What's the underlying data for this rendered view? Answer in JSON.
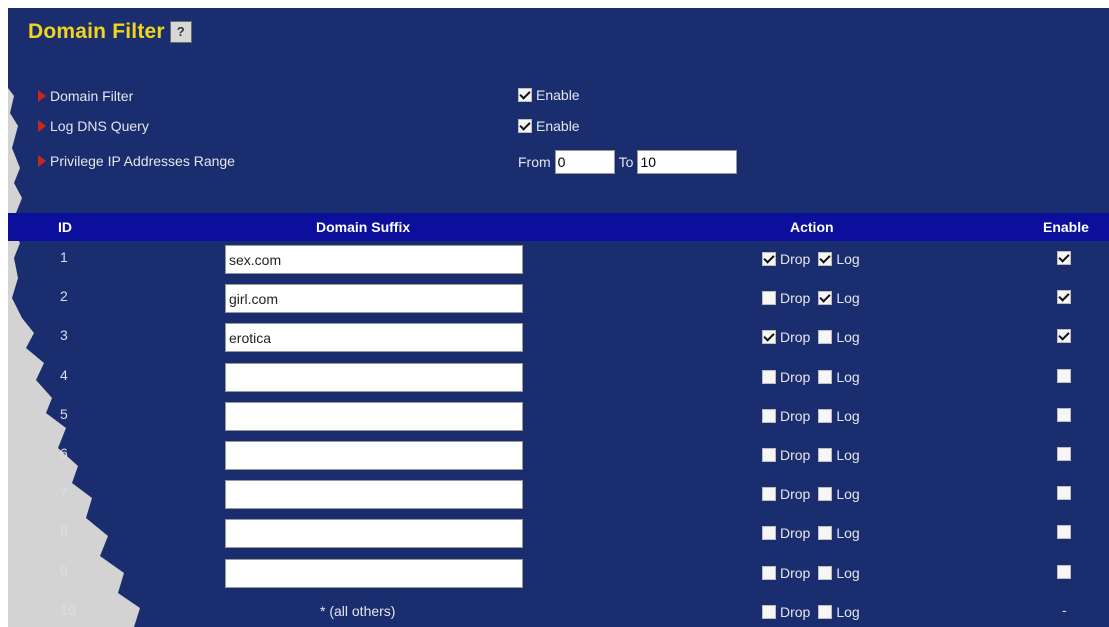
{
  "title": "Domain Filter",
  "help_icon": "help-icon",
  "options": [
    {
      "label": "Domain Filter",
      "control": "checkbox",
      "checked": true,
      "text": "Enable"
    },
    {
      "label": "Log DNS Query",
      "control": "checkbox",
      "checked": true,
      "text": "Enable"
    },
    {
      "label": "Privilege IP Addresses Range",
      "control": "range",
      "from_label": "From",
      "from_value": "0",
      "to_label": "To",
      "to_value": "10"
    }
  ],
  "table": {
    "headers": {
      "id": "ID",
      "domain": "Domain Suffix",
      "action": "Action",
      "enable": "Enable"
    },
    "action_labels": {
      "drop": "Drop",
      "log": "Log"
    },
    "rows": [
      {
        "id": "1",
        "domain": "sex.com",
        "drop": true,
        "log": true,
        "enable": true
      },
      {
        "id": "2",
        "domain": "girl.com",
        "drop": false,
        "log": true,
        "enable": true
      },
      {
        "id": "3",
        "domain": "erotica",
        "drop": true,
        "log": false,
        "enable": true
      },
      {
        "id": "4",
        "domain": "",
        "drop": false,
        "log": false,
        "enable": false
      },
      {
        "id": "5",
        "domain": "",
        "drop": false,
        "log": false,
        "enable": false
      },
      {
        "id": "6",
        "domain": "",
        "drop": false,
        "log": false,
        "enable": false
      },
      {
        "id": "7",
        "domain": "",
        "drop": false,
        "log": false,
        "enable": false
      },
      {
        "id": "8",
        "domain": "",
        "drop": false,
        "log": false,
        "enable": false
      },
      {
        "id": "9",
        "domain": "",
        "drop": false,
        "log": false,
        "enable": false
      }
    ],
    "last_row": {
      "id": "10",
      "domain_text": "* (all others)",
      "drop": false,
      "log": false,
      "enable_text": "-"
    }
  },
  "colors": {
    "panel": "#1a2d6e",
    "header": "#0b0f9c",
    "title": "#f4d41a",
    "arrow": "#c8281c"
  }
}
